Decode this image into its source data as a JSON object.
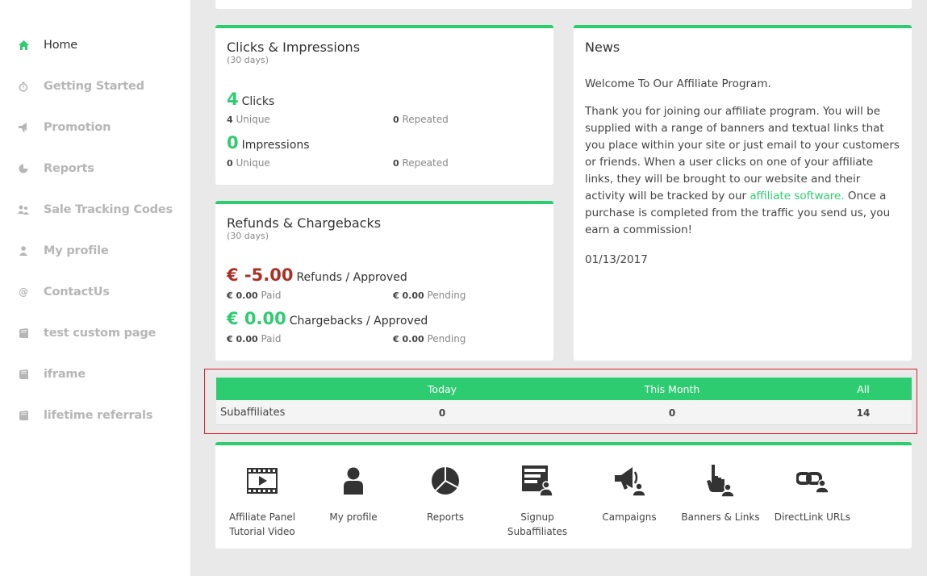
{
  "sidebar": {
    "items": [
      {
        "label": "Home",
        "icon": "home-icon"
      },
      {
        "label": "Getting Started",
        "icon": "stopwatch-icon"
      },
      {
        "label": "Promotion",
        "icon": "bullhorn-icon"
      },
      {
        "label": "Reports",
        "icon": "pie-chart-icon"
      },
      {
        "label": "Sale Tracking Codes",
        "icon": "users-icon"
      },
      {
        "label": "My profile",
        "icon": "user-icon"
      },
      {
        "label": "ContactUs",
        "icon": "at-icon"
      },
      {
        "label": "test custom page",
        "icon": "book-icon"
      },
      {
        "label": "iframe",
        "icon": "book-icon"
      },
      {
        "label": "lifetime referrals",
        "icon": "book-icon"
      }
    ],
    "active_color": "#2ecc71"
  },
  "clicks": {
    "title": "Clicks & Impressions",
    "subtitle": "(30 days)",
    "clicks_value": "4",
    "clicks_label": "Clicks",
    "clicks_unique_value": "4",
    "clicks_unique_label": "Unique",
    "clicks_repeated_value": "0",
    "clicks_repeated_label": "Repeated",
    "impressions_value": "0",
    "impressions_label": "Impressions",
    "impressions_unique_value": "0",
    "impressions_unique_label": "Unique",
    "impressions_repeated_value": "0",
    "impressions_repeated_label": "Repeated"
  },
  "refunds": {
    "title": "Refunds & Chargebacks",
    "subtitle": "(30 days)",
    "refunds_value": "€ -5.00",
    "refunds_label": "Refunds / Approved",
    "refunds_paid_value": "€ 0.00",
    "refunds_paid_label": "Paid",
    "refunds_pending_value": "€ 0.00",
    "refunds_pending_label": "Pending",
    "chargebacks_value": "€ 0.00",
    "chargebacks_label": "Chargebacks / Approved",
    "chargebacks_paid_value": "€ 0.00",
    "chargebacks_paid_label": "Paid",
    "chargebacks_pending_value": "€ 0.00",
    "chargebacks_pending_label": "Pending"
  },
  "news": {
    "title": "News",
    "headline": "Welcome To Our Affiliate Program.",
    "body_before": "Thank you for joining our affiliate program. You will be supplied with a range of banners and textual links that you place within your site or just email to your customers or friends. When a user clicks on one of your affiliate links, they will be brought to our website and their activity will be tracked by our ",
    "link_text": "affiliate software.",
    "body_after": " Once a purchase is completed from the traffic you send us, you earn a commission!",
    "date": "01/13/2017"
  },
  "subaffiliates": {
    "headers": [
      "Today",
      "This Month",
      "All"
    ],
    "row_label": "Subaffiliates",
    "values": [
      "0",
      "0",
      "14"
    ]
  },
  "quicklinks": [
    {
      "label_line1": "Affiliate Panel",
      "label_line2": "Tutorial Video",
      "icon": "video-icon"
    },
    {
      "label_line1": "My profile",
      "label_line2": "",
      "icon": "person-icon"
    },
    {
      "label_line1": "Reports",
      "label_line2": "",
      "icon": "pie-chart-icon"
    },
    {
      "label_line1": "Signup",
      "label_line2": "Subaffiliates",
      "icon": "signup-form-icon"
    },
    {
      "label_line1": "Campaigns",
      "label_line2": "",
      "icon": "megaphone-icon"
    },
    {
      "label_line1": "Banners & Links",
      "label_line2": "",
      "icon": "pointer-hand-icon"
    },
    {
      "label_line1": "DirectLink URLs",
      "label_line2": "",
      "icon": "link-chain-icon"
    }
  ],
  "colors": {
    "accent": "#2ecc71",
    "negative": "#a93226",
    "highlight_border": "#d9232d"
  }
}
